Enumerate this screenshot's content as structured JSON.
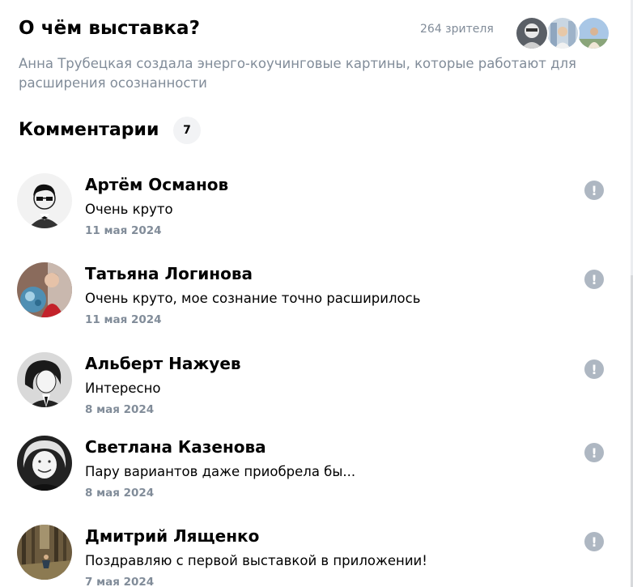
{
  "header": {
    "title": "О чём выставка?",
    "viewers": "264 зрителя"
  },
  "description": "Анна Трубецкая создала энерго-коучинговые картины, которые работают для расширения осознанности",
  "comments": {
    "title": "Комментарии",
    "count": "7",
    "items": [
      {
        "name": "Артём Османов",
        "text": "Очень круто",
        "date": "11 мая 2024"
      },
      {
        "name": "Татьяна Логинова",
        "text": "Очень круто, мое сознание точно расширилось",
        "date": "11 мая 2024"
      },
      {
        "name": "Альберт Нажуев",
        "text": "Интересно",
        "date": "8 мая 2024"
      },
      {
        "name": "Светлана Казенова",
        "text": "Пару вариантов даже приобрела бы...",
        "date": "8 мая 2024"
      },
      {
        "name": "Дмитрий Лященко",
        "text": "Поздравляю с первой выставкой в приложении!",
        "date": "7 мая 2024"
      }
    ]
  },
  "icons": {
    "report": "exclamation-circle-icon",
    "report_glyph": "!"
  },
  "colors": {
    "secondary_text": "#818c99",
    "report_icon": "#aeb7c2",
    "counter_bg": "#f2f3f5"
  }
}
